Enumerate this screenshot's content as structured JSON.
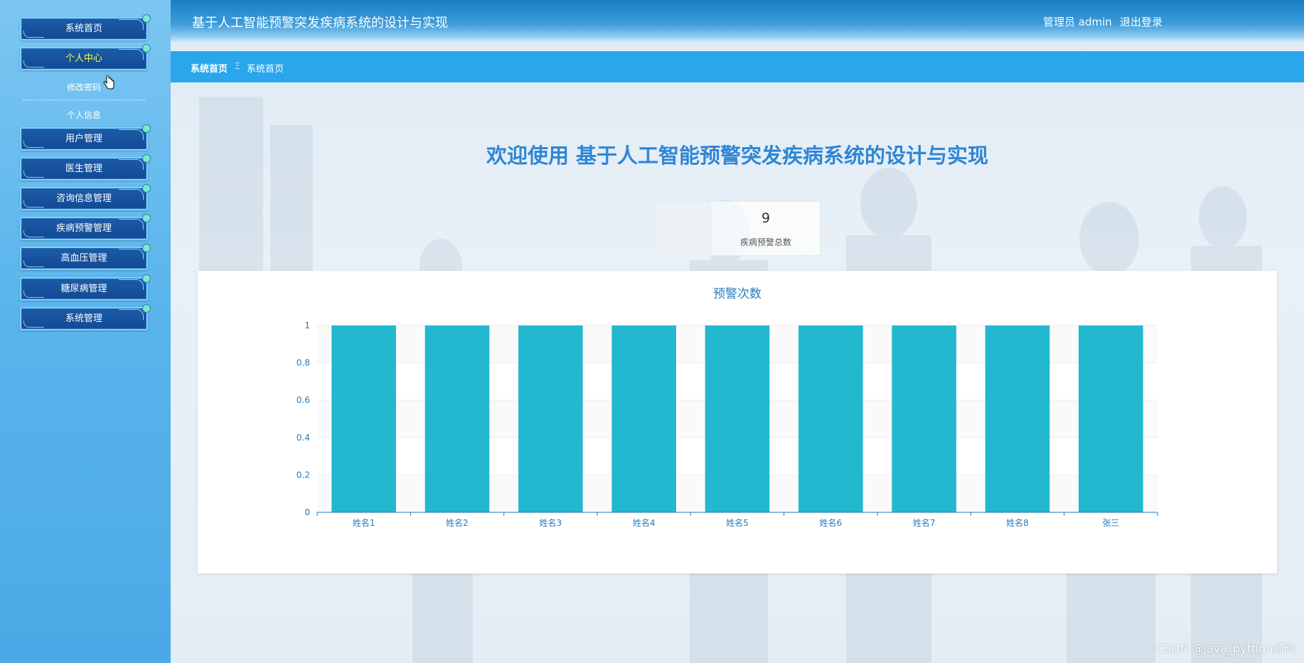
{
  "header": {
    "title": "基于人工智能预警突发疾病系统的设计与实现",
    "user": "管理员 admin",
    "logout": "退出登录"
  },
  "sidebar": {
    "items": [
      {
        "label": "系统首页",
        "active": false
      },
      {
        "label": "个人中心",
        "active": true
      },
      {
        "label": "用户管理",
        "active": false
      },
      {
        "label": "医生管理",
        "active": false
      },
      {
        "label": "咨询信息管理",
        "active": false
      },
      {
        "label": "疾病预警管理",
        "active": false
      },
      {
        "label": "高血压管理",
        "active": false
      },
      {
        "label": "糖尿病管理",
        "active": false
      },
      {
        "label": "系统管理",
        "active": false
      }
    ],
    "subitems": [
      {
        "label": "修改密码"
      },
      {
        "label": "个人信息"
      }
    ]
  },
  "breadcrumb": {
    "root": "系统首页",
    "separator": "Ξ",
    "current": "系统首页"
  },
  "welcome": "欢迎使用 基于人工智能预警突发疾病系统的设计与实现",
  "stat": {
    "value": "9",
    "label": "疾病预警总数"
  },
  "chart_data": {
    "type": "bar",
    "title": "预警次数",
    "categories": [
      "姓名1",
      "姓名2",
      "姓名3",
      "姓名4",
      "姓名5",
      "姓名6",
      "姓名7",
      "姓名8",
      "张三"
    ],
    "values": [
      1,
      1,
      1,
      1,
      1,
      1,
      1,
      1,
      1
    ],
    "xlabel": "",
    "ylabel": "",
    "ylim": [
      0,
      1
    ],
    "yticks": [
      0,
      0.2,
      0.4,
      0.6,
      0.8,
      1
    ],
    "color": "#22b8cf",
    "grid": true
  },
  "watermark": "CSDN @java_python源码",
  "colors": {
    "accent": "#2aa6ec",
    "menu_bg": "#1a559f",
    "active_text": "#f7ff3b",
    "welcome": "#2f86d6",
    "bar": "#22b8cf"
  }
}
